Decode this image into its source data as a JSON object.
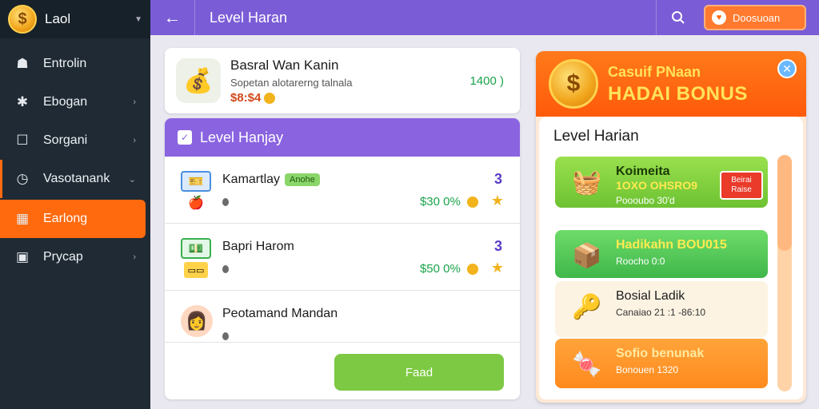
{
  "sidebar": {
    "brand": "Laol",
    "items": [
      {
        "label": "Entrolin",
        "icon": "chef-hat-icon"
      },
      {
        "label": "Ebogan",
        "icon": "puzzle-icon"
      },
      {
        "label": "Sorgani",
        "icon": "square-icon"
      },
      {
        "label": "Vasotanank",
        "icon": "clock-icon"
      },
      {
        "label": "Earlong",
        "icon": "grid-icon"
      },
      {
        "label": "Prycap",
        "icon": "package-icon"
      }
    ]
  },
  "topbar": {
    "title": "Level Haran",
    "action_label": "Doosuoan"
  },
  "featured": {
    "title": "Basral Wan Kanin",
    "subtitle": "Sopetan alotarerng talnala",
    "price": "$8:$4",
    "amount": "1400 )"
  },
  "tasks": {
    "header": "Level Hanjay",
    "rows": [
      {
        "title": "Kamartlay",
        "tag": "Anohe",
        "progress": "$30 0%",
        "count": "3"
      },
      {
        "title": "Bapri Harom",
        "tag": "",
        "progress": "$50 0%",
        "count": "3"
      },
      {
        "title": "Peotamand Mandan",
        "tag": "",
        "progress": "",
        "count": ""
      }
    ],
    "claim_label": "Faad"
  },
  "bonus": {
    "title_small": "Casuif PNaan",
    "title_big": "HADAI BONUS",
    "section_title": "Level Harian",
    "tiles": [
      {
        "title": "Koimeita",
        "line2": "1OXO OHSRO9",
        "line3": "Poooubo 30'd",
        "tag": "Beirai Raise"
      },
      {
        "title": "Hadikahn BOU015",
        "line2": "Roocho 0:0"
      },
      {
        "title": "Bosial Ladik",
        "line2": "Canaiao 21 :1 -86:10"
      },
      {
        "title": "Sofio benunak",
        "line2": "Bonouen 1320"
      }
    ]
  },
  "colors": {
    "sidebar_bg": "#1f2a34",
    "accent_purple": "#7a5cd6",
    "accent_orange": "#ff6a0e",
    "claim_green": "#7dc943"
  }
}
